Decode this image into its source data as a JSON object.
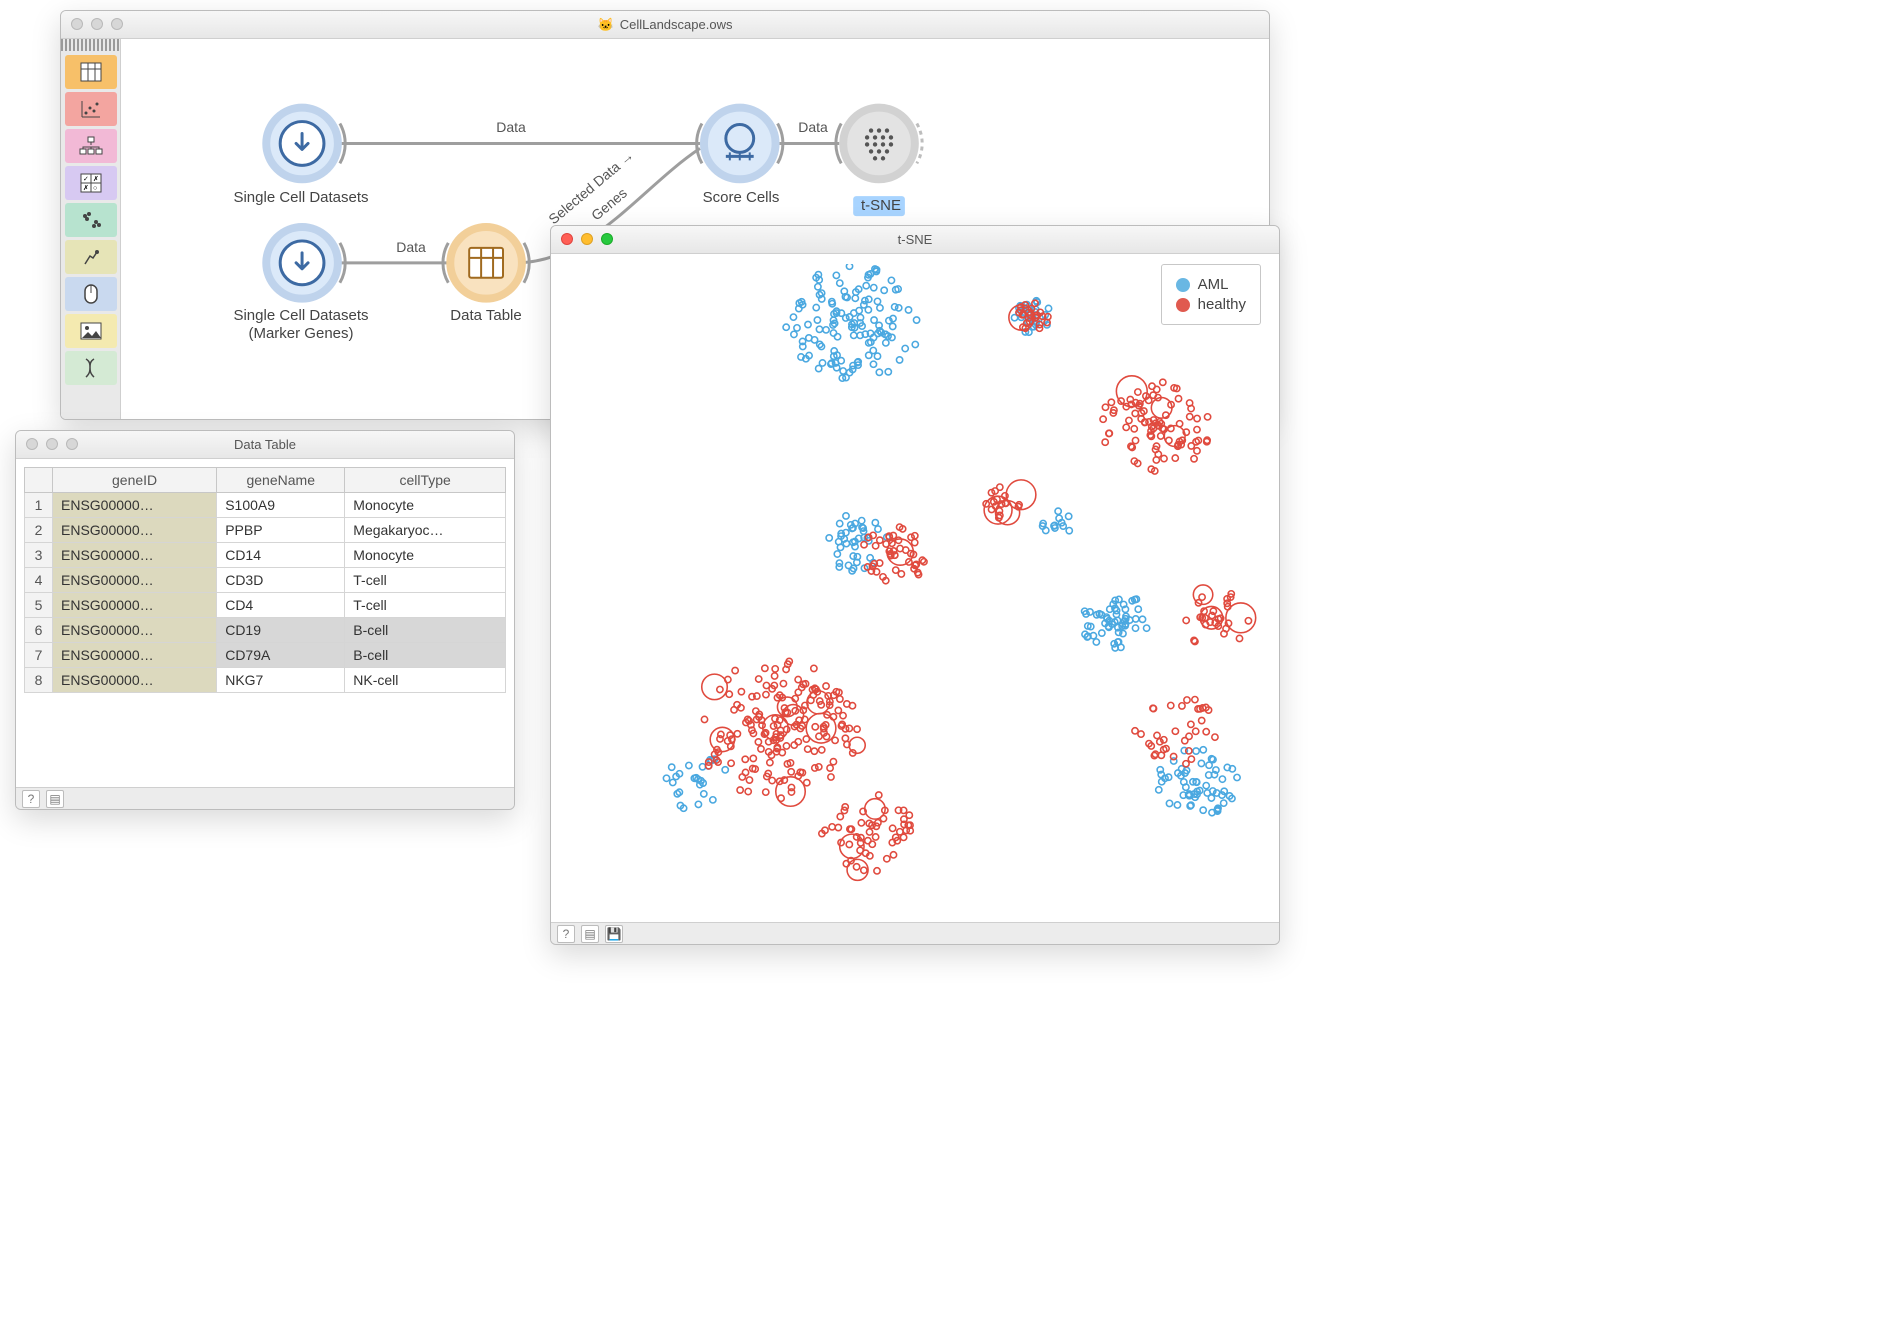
{
  "windows": {
    "canvas": {
      "title": "CellLandscape.ows",
      "toolbox": [
        {
          "name": "file",
          "color": "#f7c069",
          "icon": "grid"
        },
        {
          "name": "scatter",
          "color": "#f3a5a0",
          "icon": "dots"
        },
        {
          "name": "tree",
          "color": "#f2b9d6",
          "icon": "tree"
        },
        {
          "name": "confusion",
          "color": "#d7c9f2",
          "icon": "matrix"
        },
        {
          "name": "cluster",
          "color": "#b7e3cf",
          "icon": "cluster"
        },
        {
          "name": "person",
          "color": "#e6e4b7",
          "icon": "dig"
        },
        {
          "name": "mouse",
          "color": "#c9d9ef",
          "icon": "mouse"
        },
        {
          "name": "image",
          "color": "#f4eab0",
          "icon": "image"
        },
        {
          "name": "dna",
          "color": "#d4ead4",
          "icon": "dna"
        }
      ],
      "nodes": {
        "scd1": "Single Cell Datasets",
        "scd2a": "Single Cell Datasets",
        "scd2b": "(Marker Genes)",
        "dt": "Data Table",
        "score": "Score Cells",
        "tsne": "t-SNE"
      },
      "links": {
        "l1": "Data",
        "l2": "Data",
        "l3": "Selected Data",
        "l3b": "Genes",
        "l4": "Data"
      }
    },
    "table": {
      "title": "Data Table",
      "columns": [
        "",
        "geneID",
        "geneName",
        "cellType"
      ],
      "rows": [
        {
          "n": "1",
          "id": "ENSG00000…",
          "name": "S100A9",
          "type": "Monocyte",
          "sel": false
        },
        {
          "n": "2",
          "id": "ENSG00000…",
          "name": "PPBP",
          "type": "Megakaryoc…",
          "sel": false
        },
        {
          "n": "3",
          "id": "ENSG00000…",
          "name": "CD14",
          "type": "Monocyte",
          "sel": false
        },
        {
          "n": "4",
          "id": "ENSG00000…",
          "name": "CD3D",
          "type": "T-cell",
          "sel": false
        },
        {
          "n": "5",
          "id": "ENSG00000…",
          "name": "CD4",
          "type": "T-cell",
          "sel": false
        },
        {
          "n": "6",
          "id": "ENSG00000…",
          "name": "CD19",
          "type": "B-cell",
          "sel": true
        },
        {
          "n": "7",
          "id": "ENSG00000…",
          "name": "CD79A",
          "type": "B-cell",
          "sel": true
        },
        {
          "n": "8",
          "id": "ENSG00000…",
          "name": "NKG7",
          "type": "NK-cell",
          "sel": false
        }
      ]
    },
    "tsne": {
      "title": "t-SNE",
      "legend": [
        {
          "key": "aml",
          "label": "AML",
          "color": "#69b7e3"
        },
        {
          "key": "hea",
          "label": "healthy",
          "color": "#e05a4f"
        }
      ]
    }
  },
  "chart_data": {
    "type": "scatter",
    "title": "t-SNE",
    "xlabel": "",
    "ylabel": "",
    "xlim": [
      0,
      100
    ],
    "ylim": [
      0,
      100
    ],
    "legend_position": "top-right",
    "note": "axes unlabeled in screenshot; x/y are arbitrary t-SNE components",
    "series": [
      {
        "name": "AML",
        "color": "#4aa8e0",
        "clusters": [
          {
            "cx": 41,
            "cy": 9,
            "n": 130,
            "spread": 10
          },
          {
            "cx": 67,
            "cy": 8,
            "n": 28,
            "spread": 3
          },
          {
            "cx": 41,
            "cy": 43,
            "n": 40,
            "spread": 5
          },
          {
            "cx": 79,
            "cy": 55,
            "n": 55,
            "spread": 5
          },
          {
            "cx": 70,
            "cy": 40,
            "n": 12,
            "spread": 3
          },
          {
            "cx": 91,
            "cy": 80,
            "n": 60,
            "spread": 6
          },
          {
            "cx": 18,
            "cy": 80,
            "n": 25,
            "spread": 5
          }
        ]
      },
      {
        "name": "healthy",
        "color": "#e04a3e",
        "clusters": [
          {
            "cx": 67,
            "cy": 8,
            "n": 25,
            "spread": 2.5
          },
          {
            "cx": 85,
            "cy": 25,
            "n": 90,
            "spread": 8
          },
          {
            "cx": 47,
            "cy": 45,
            "n": 45,
            "spread": 5
          },
          {
            "cx": 63,
            "cy": 37,
            "n": 20,
            "spread": 3
          },
          {
            "cx": 30,
            "cy": 72,
            "n": 180,
            "spread": 12
          },
          {
            "cx": 43,
            "cy": 88,
            "n": 55,
            "spread": 7
          },
          {
            "cx": 94,
            "cy": 55,
            "n": 30,
            "spread": 5
          },
          {
            "cx": 88,
            "cy": 72,
            "n": 35,
            "spread": 6
          }
        ]
      }
    ]
  }
}
